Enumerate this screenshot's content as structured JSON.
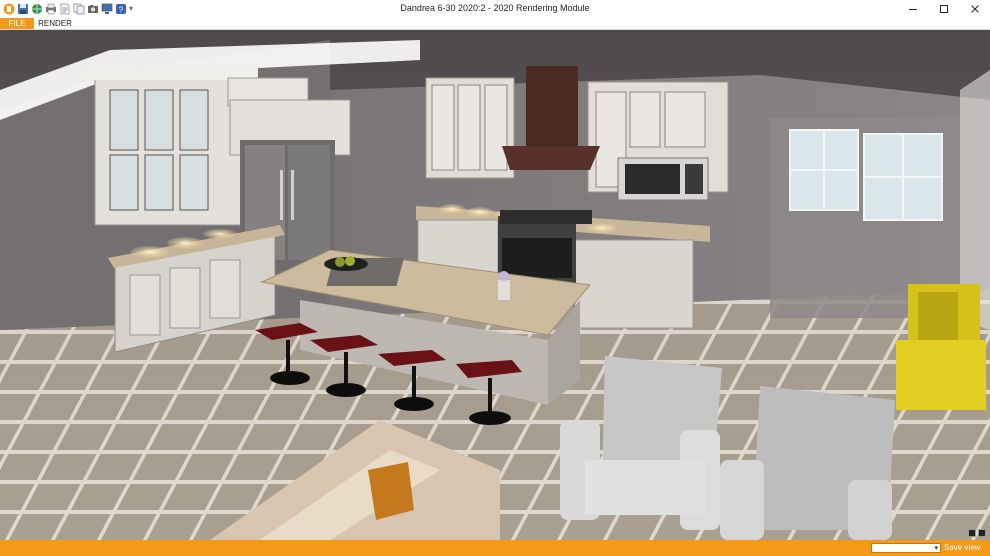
{
  "window": {
    "title": "Dandrea 6-30 2020:2 - 2020 Rendering Module"
  },
  "quick_access_toolbar": {
    "icons": [
      "app-icon",
      "save-icon",
      "globe-icon",
      "print-icon",
      "document-icon",
      "copy-icon",
      "camera-icon",
      "monitor-icon",
      "help-icon"
    ],
    "more_glyph": "▾"
  },
  "menu": {
    "file_label": "FILE",
    "render_label": "RENDER"
  },
  "status_bar": {
    "view_select_value": "",
    "view_select_arrow": "▾",
    "save_view_label": "Save view"
  },
  "colors": {
    "accent": "#f39a18",
    "floor_tile": "#a69c8e",
    "cabinet": "#dedbd6",
    "countertop": "#c9b79b",
    "stool_seat": "#6a1116",
    "armchair": "#c8c8c8",
    "accent_chair": "#d6c21a",
    "wall": "#7c7778"
  }
}
